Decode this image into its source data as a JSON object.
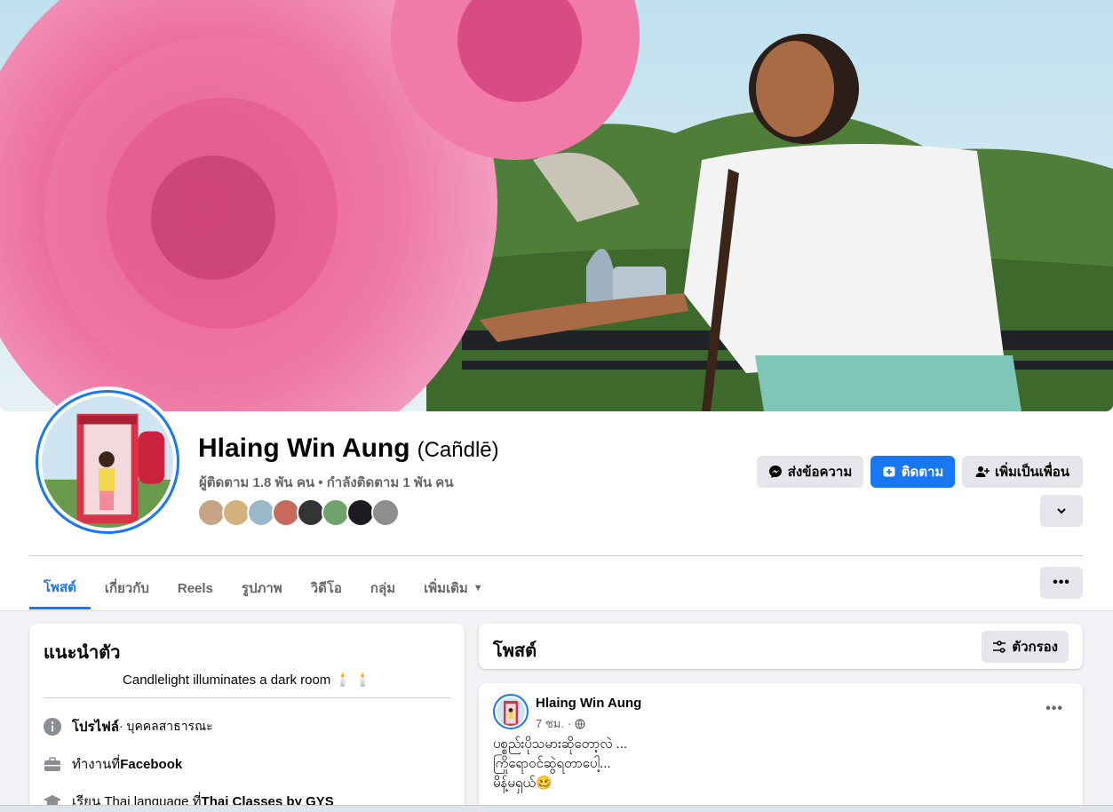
{
  "profile": {
    "name": "Hlaing Win Aung",
    "alternate_name": "(Cañdlē)",
    "stats": "ผู้ติดตาม 1.8 พัน คน • กำลังติดตาม 1 พัน คน"
  },
  "actions": {
    "message": "ส่งข้อความ",
    "follow": "ติดตาม",
    "add_friend": "เพิ่มเป็นเพื่อน",
    "expand_icon": "chevron-down-icon"
  },
  "tabs": [
    {
      "label": "โพสต์",
      "active": true
    },
    {
      "label": "เกี่ยวกับ"
    },
    {
      "label": "Reels"
    },
    {
      "label": "รูปภาพ"
    },
    {
      "label": "วิดีโอ"
    },
    {
      "label": "กลุ่ม"
    },
    {
      "label": "เพิ่มเติม"
    }
  ],
  "more_dots": "•••",
  "intro": {
    "title": "แนะนำตัว",
    "bio": "Candlelight illuminates a dark room 🕯️ 🕯️",
    "items": [
      {
        "bold": "โปรไฟล์",
        "rest": " · บุคคลสาธารณะ",
        "icon": "info-icon"
      },
      {
        "prefix": "ทำงานที่ ",
        "bold": "Facebook",
        "icon": "briefcase-icon"
      },
      {
        "prefix": "เรียน Thai language ที่ ",
        "bold": "Thai Classes by GYS",
        "icon": "graduation-cap-icon"
      }
    ]
  },
  "posts_section": {
    "title": "โพสต์",
    "filter_label": "ตัวกรอง"
  },
  "post": {
    "author": "Hlaing Win Aung",
    "time": "7 ชม.",
    "privacy_icon": "globe-icon",
    "lines": [
      "ပစ္စည်းပိုသမားဆိုတော့လဲ ...",
      "ကြိုရောဝင်ဆွဲရတာပေါ့...",
      "မိန့်မရှယ်🥴"
    ]
  },
  "colors": {
    "accent": "#1877f2",
    "background": "#f0f2f5",
    "button_grey": "#e4e6eb"
  }
}
